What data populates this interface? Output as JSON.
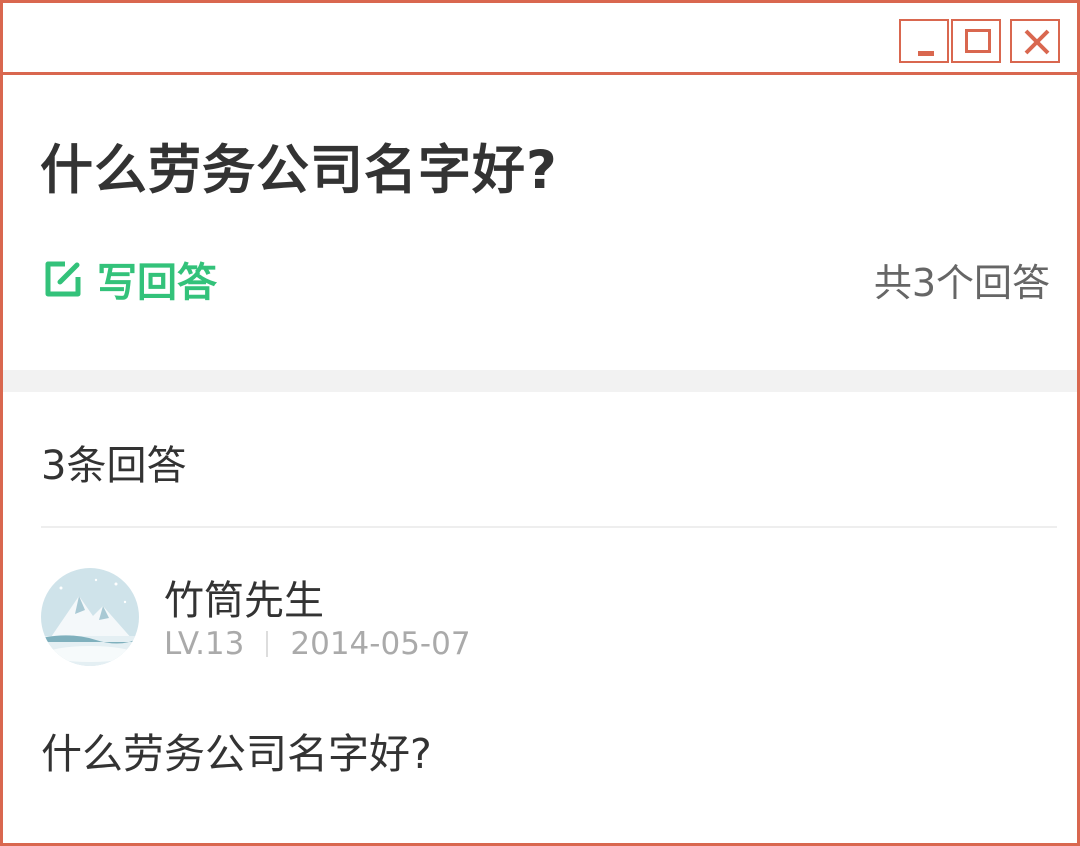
{
  "window": {
    "controls": {
      "minimize": "minimize",
      "maximize": "maximize",
      "close": "close"
    },
    "border_color": "#d9674f"
  },
  "question": {
    "title": "什么劳务公司名字好?",
    "write_answer_label": "写回答",
    "write_answer_icon": "edit-icon",
    "total_answers": "共3个回答"
  },
  "answers": {
    "count_label": "3条回答",
    "items": [
      {
        "username": "竹筒先生",
        "level": "LV.13",
        "date": "2014-05-07",
        "avatar_icon": "snowy-mountain-avatar",
        "text": "什么劳务公司名字好?"
      }
    ]
  },
  "colors": {
    "accent_green": "#33c27a",
    "title_text": "#333333",
    "muted_text": "#aaaaaa",
    "separator_band": "#f2f2f2"
  }
}
